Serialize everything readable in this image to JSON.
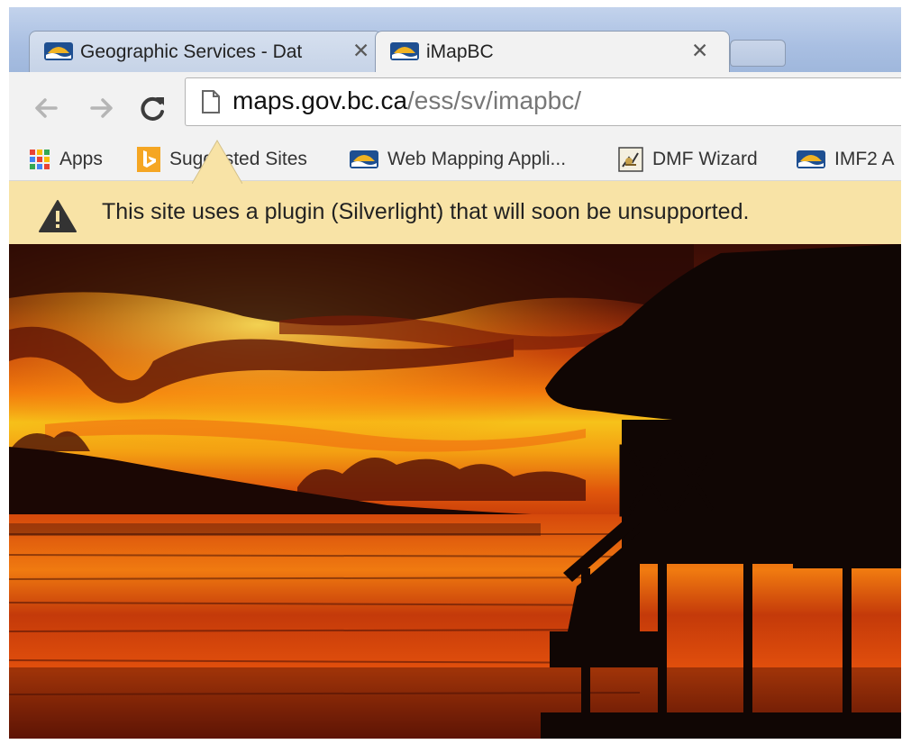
{
  "tabs": [
    {
      "title": "Geographic Services - Dat",
      "active": false
    },
    {
      "title": "iMapBC",
      "active": true
    }
  ],
  "address": {
    "host": "maps.gov.bc.ca",
    "path": "/ess/sv/imapbc/"
  },
  "bookmarks": [
    {
      "label": "Apps",
      "icon": "apps-grid-icon"
    },
    {
      "label": "Suggested Sites",
      "icon": "bing-icon"
    },
    {
      "label": "Web Mapping Appli...",
      "icon": "bc-gov-icon"
    },
    {
      "label": "DMF Wizard",
      "icon": "dmf-icon"
    },
    {
      "label": "IMF2 A",
      "icon": "bc-gov-icon"
    }
  ],
  "infobar": {
    "message": "This site uses a plugin (Silverlight) that will soon be unsupported.",
    "icon": "warning-icon"
  },
  "content": {
    "description_icon": "sunset-photo"
  },
  "colors": {
    "infobar": "#f8e3a6",
    "tabstrip": "#a9bfe2",
    "bc_blue": "#1e4f91",
    "bc_gold": "#f0b323"
  }
}
